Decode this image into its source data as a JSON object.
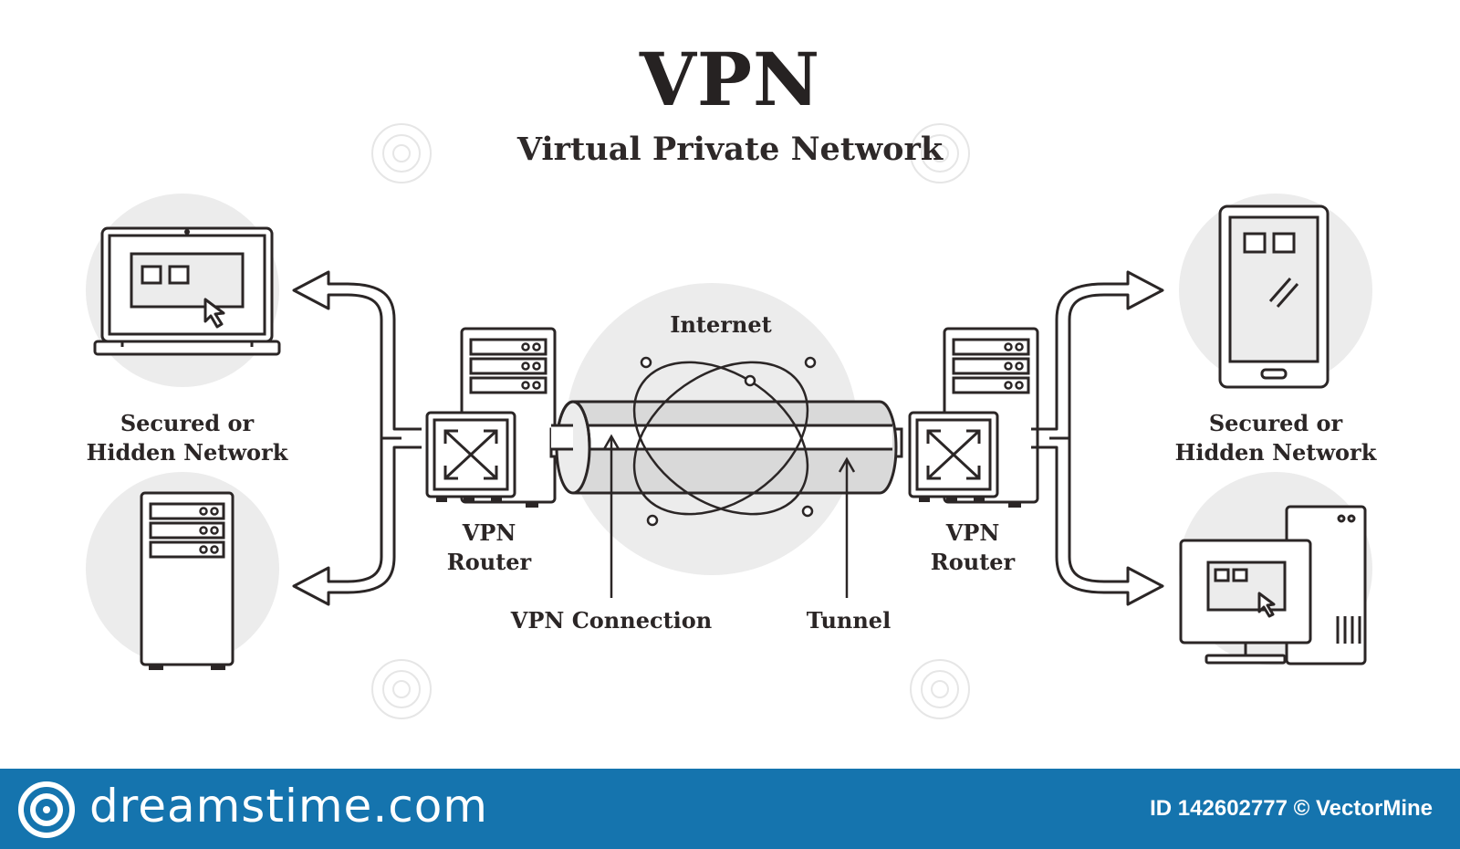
{
  "diagram": {
    "title": "VPN",
    "subtitle": "Virtual Private Network",
    "labels": {
      "left_network": [
        "Secured or",
        "Hidden Network"
      ],
      "right_network": [
        "Secured or",
        "Hidden Network"
      ],
      "left_router": [
        "VPN",
        "Router"
      ],
      "right_router": [
        "VPN",
        "Router"
      ],
      "internet": "Internet",
      "vpn_connection": "VPN Connection",
      "tunnel": "Tunnel"
    },
    "watermark": "dreamstime"
  },
  "footer": {
    "logo": "dreamstime.com",
    "image_id": "ID 142602777 © VectorMine"
  },
  "colors": {
    "stroke": "#2b2626",
    "circle_fill": "#ececec",
    "footer_bg": "#1574ae"
  }
}
